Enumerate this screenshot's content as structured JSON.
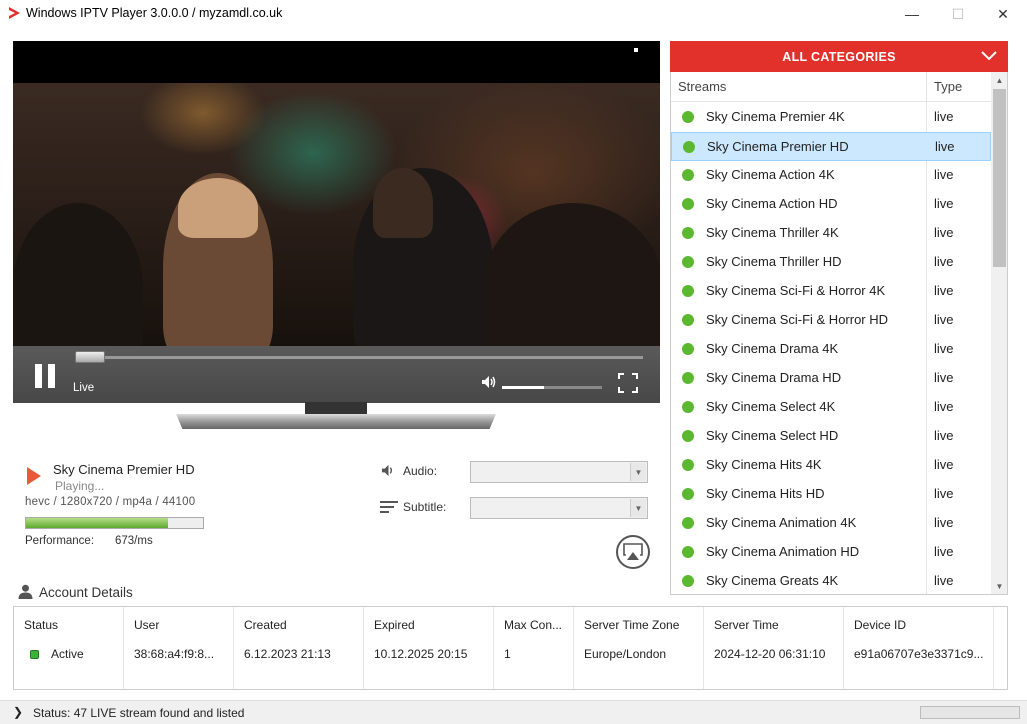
{
  "window": {
    "title": "Windows IPTV Player 3.0.0.0 / myzamdl.co.uk",
    "minimize": "—",
    "maximize": "☐",
    "close": "✕"
  },
  "player": {
    "live_label": "Live",
    "seek_position": 0.05,
    "volume_level": 0.42
  },
  "now_playing": {
    "title": "Sky Cinema Premier HD",
    "state": "Playing...",
    "codec_info": "hevc / 1280x720 / mp4a / 44100",
    "buffer_level": 0.8,
    "performance_label": "Performance:",
    "performance_value": "673/ms"
  },
  "options": {
    "audio_label": "Audio:",
    "audio_value": "",
    "subtitle_label": "Subtitle:",
    "subtitle_value": ""
  },
  "categories": {
    "header": "ALL CATEGORIES",
    "col_streams": "Streams",
    "col_type": "Type",
    "streams": [
      {
        "name": "Sky Cinema Premier 4K",
        "type": "live",
        "selected": false
      },
      {
        "name": "Sky Cinema Premier HD",
        "type": "live",
        "selected": true
      },
      {
        "name": "Sky Cinema Action 4K",
        "type": "live",
        "selected": false
      },
      {
        "name": "Sky Cinema Action HD",
        "type": "live",
        "selected": false
      },
      {
        "name": "Sky Cinema Thriller 4K",
        "type": "live",
        "selected": false
      },
      {
        "name": "Sky Cinema Thriller HD",
        "type": "live",
        "selected": false
      },
      {
        "name": "Sky Cinema Sci-Fi & Horror 4K",
        "type": "live",
        "selected": false
      },
      {
        "name": "Sky Cinema Sci-Fi & Horror HD",
        "type": "live",
        "selected": false
      },
      {
        "name": "Sky Cinema Drama 4K",
        "type": "live",
        "selected": false
      },
      {
        "name": "Sky Cinema Drama HD",
        "type": "live",
        "selected": false
      },
      {
        "name": "Sky Cinema Select 4K",
        "type": "live",
        "selected": false
      },
      {
        "name": "Sky Cinema Select HD",
        "type": "live",
        "selected": false
      },
      {
        "name": "Sky Cinema Hits 4K",
        "type": "live",
        "selected": false
      },
      {
        "name": "Sky Cinema Hits HD",
        "type": "live",
        "selected": false
      },
      {
        "name": "Sky Cinema Animation 4K",
        "type": "live",
        "selected": false
      },
      {
        "name": "Sky Cinema Animation HD",
        "type": "live",
        "selected": false
      },
      {
        "name": "Sky Cinema Greats 4K",
        "type": "live",
        "selected": false
      }
    ]
  },
  "account": {
    "title": "Account Details",
    "columns": [
      {
        "header": "Status",
        "value": "Active"
      },
      {
        "header": "User",
        "value": "38:68:a4:f9:8..."
      },
      {
        "header": "Created",
        "value": "6.12.2023 21:13"
      },
      {
        "header": "Expired",
        "value": "10.12.2025 20:15"
      },
      {
        "header": "Max Con...",
        "value": "1"
      },
      {
        "header": "Server Time Zone",
        "value": "Europe/London"
      },
      {
        "header": "Server Time",
        "value": "2024-12-20 06:31:10"
      },
      {
        "header": "Device ID",
        "value": "e91a06707e3e3371c9..."
      }
    ]
  },
  "statusbar": {
    "chevron": "❯",
    "text": "Status: 47 LIVE stream found and listed"
  },
  "colors": {
    "accent": "#e2312b",
    "live_dot": "#5cb830",
    "selection": "#cce8ff"
  },
  "icons": {
    "app": "play-triangle-icon",
    "volume": "speaker-icon",
    "fullscreen": "fullscreen-icon",
    "audio": "speaker-icon",
    "subtitle": "lines-icon",
    "cast": "airplay-icon",
    "account": "user-icon",
    "category_toggle": "chevron-down-icon"
  }
}
